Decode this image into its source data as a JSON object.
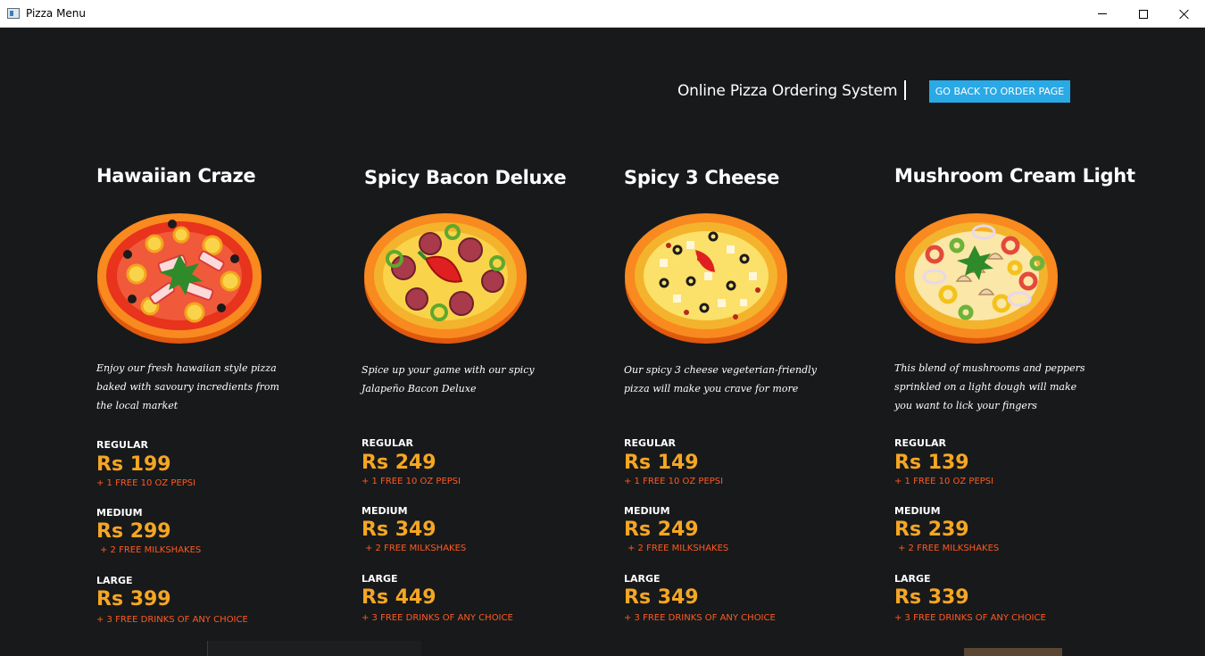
{
  "window": {
    "title": "Pizza Menu",
    "controls": {
      "minimize": "minimize",
      "maximize": "maximize",
      "close": "close"
    }
  },
  "header": {
    "system_title": "Online Pizza Ordering System",
    "separator": "|",
    "back_button": "GO BACK TO ORDER PAGE"
  },
  "colors": {
    "background": "#18191b",
    "accent_button": "#29a9e6",
    "price": "#f5a623",
    "offer": "#ff5a1f",
    "text": "#ffffff"
  },
  "pizzas": [
    {
      "name": "Hawaiian Craze",
      "image": "hawaiian-pizza-icon",
      "description_lines": [
        "Enjoy our fresh hawaiian style pizza",
        "baked with savoury incredients from",
        "the local market"
      ],
      "sizes": [
        {
          "label": "REGULAR",
          "price": "Rs 199",
          "offer": "+ 1 FREE 10 OZ PEPSI"
        },
        {
          "label": "MEDIUM",
          "price": "Rs 299",
          "offer": "+ 2 FREE MILKSHAKES"
        },
        {
          "label": "LARGE",
          "price": "Rs 399",
          "offer": "+ 3 FREE DRINKS OF ANY CHOICE"
        }
      ]
    },
    {
      "name": "Spicy Bacon Deluxe",
      "image": "spicy-bacon-pizza-icon",
      "description_lines": [
        "Spice up your game with our spicy",
        "Jalapeño Bacon Deluxe"
      ],
      "sizes": [
        {
          "label": "REGULAR",
          "price": "Rs 249",
          "offer": "+ 1 FREE 10 OZ PEPSI"
        },
        {
          "label": "MEDIUM",
          "price": "Rs 349",
          "offer": "+ 2 FREE MILKSHAKES"
        },
        {
          "label": "LARGE",
          "price": "Rs 449",
          "offer": "+ 3 FREE DRINKS OF ANY CHOICE"
        }
      ]
    },
    {
      "name": "Spicy 3 Cheese",
      "image": "three-cheese-pizza-icon",
      "description_lines": [
        "Our spicy 3 cheese vegeterian-friendly",
        "pizza will make you crave for more"
      ],
      "sizes": [
        {
          "label": "REGULAR",
          "price": "Rs 149",
          "offer": "+ 1 FREE 10 OZ PEPSI"
        },
        {
          "label": "MEDIUM",
          "price": "Rs 249",
          "offer": "+ 2 FREE MILKSHAKES"
        },
        {
          "label": "LARGE",
          "price": "Rs 349",
          "offer": "+ 3 FREE DRINKS OF ANY CHOICE"
        }
      ]
    },
    {
      "name": "Mushroom Cream Light",
      "image": "mushroom-pizza-icon",
      "description_lines": [
        "This blend of mushrooms and peppers",
        "sprinkled on a light dough will make",
        "you want to lick your fingers"
      ],
      "sizes": [
        {
          "label": "REGULAR",
          "price": "Rs 139",
          "offer": "+ 1 FREE 10 OZ PEPSI"
        },
        {
          "label": "MEDIUM",
          "price": "Rs 239",
          "offer": "+ 2 FREE MILKSHAKES"
        },
        {
          "label": "LARGE",
          "price": "Rs 339",
          "offer": "+ 3 FREE DRINKS OF ANY CHOICE"
        }
      ]
    }
  ]
}
